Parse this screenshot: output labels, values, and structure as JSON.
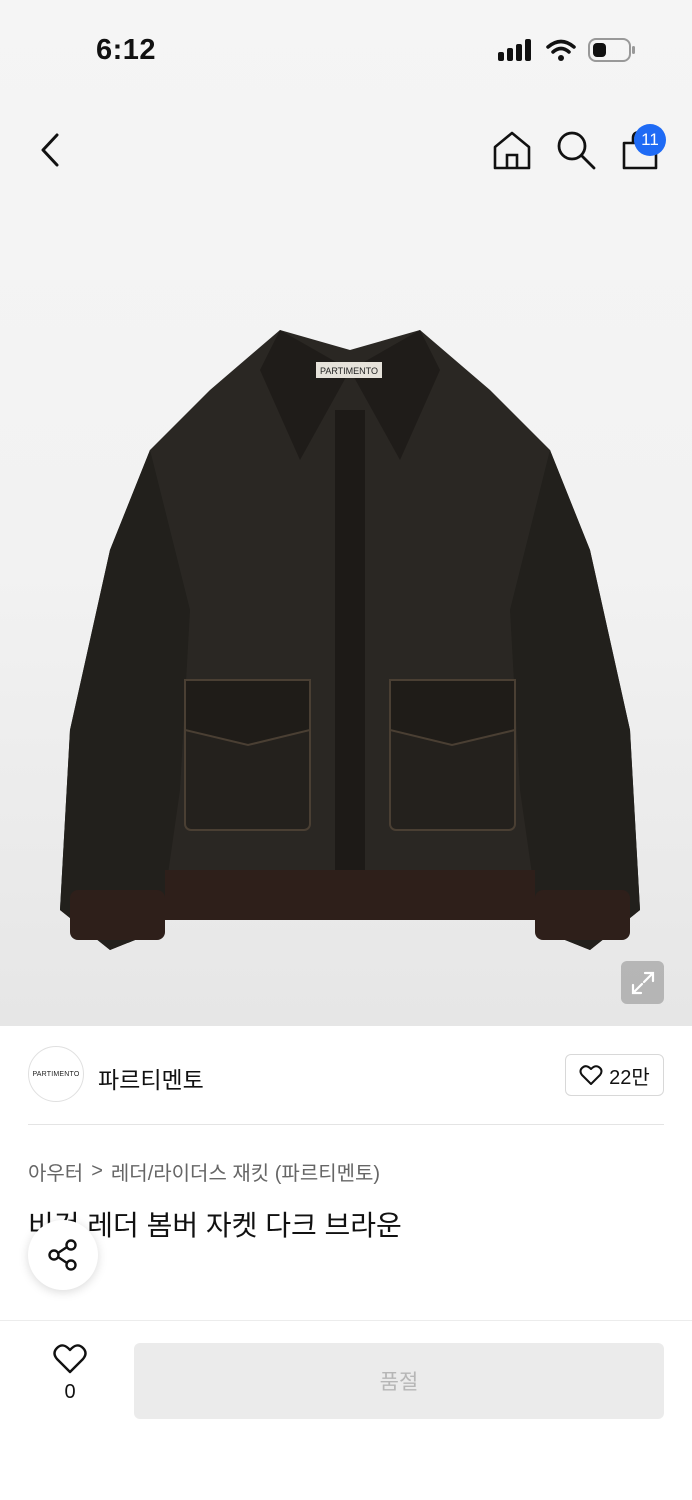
{
  "status": {
    "time": "6:12"
  },
  "nav": {
    "cart_count": "11"
  },
  "product_image": {
    "tag_text": "PARTIMENTO"
  },
  "brand": {
    "logo_text": "PARTIMENTO",
    "name": "파르티멘토",
    "likes": "22만"
  },
  "breadcrumb": {
    "category": "아우터",
    "separator": ">",
    "subcategory": "레더/라이더스 재킷 (파르티멘토)"
  },
  "product": {
    "title": "비건 레더 봄버 자켓 다크 브라운"
  },
  "bottom": {
    "wish_count": "0",
    "cta_label": "품절"
  },
  "colors": {
    "badge": "#1f6bf5",
    "soldout_bg": "#ebebeb",
    "soldout_text": "#b6b6b6"
  }
}
